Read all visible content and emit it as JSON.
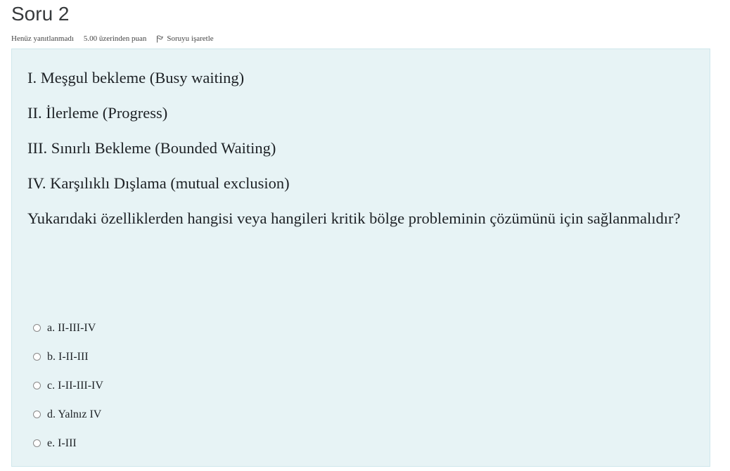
{
  "question": {
    "title": "Soru 2",
    "status": "Henüz yanıtlanmadı",
    "mark": "5.00 üzerinden puan",
    "flag_label": "Soruyu işaretle",
    "statements": [
      "I. Meşgul bekleme (Busy waiting)",
      "II. İlerleme (Progress)",
      "III. Sınırlı Bekleme (Bounded Waiting)",
      "IV. Karşılıklı Dışlama (mutual exclusion)"
    ],
    "prompt": "Yukarıdaki özelliklerden hangisi veya hangileri kritik bölge probleminin çözümünü için sağlanmalıdır?"
  },
  "answers": [
    {
      "label": "a. II-III-IV"
    },
    {
      "label": "b. I-II-III"
    },
    {
      "label": "c. I-II-III-IV"
    },
    {
      "label": "d. Yalnız IV"
    },
    {
      "label": "e. I-III"
    }
  ],
  "colors": {
    "question_background": "#e7f3f5",
    "question_border": "#cfe7ec"
  },
  "icons": {
    "flag": "flag-icon",
    "radio": "radio-unchecked"
  }
}
